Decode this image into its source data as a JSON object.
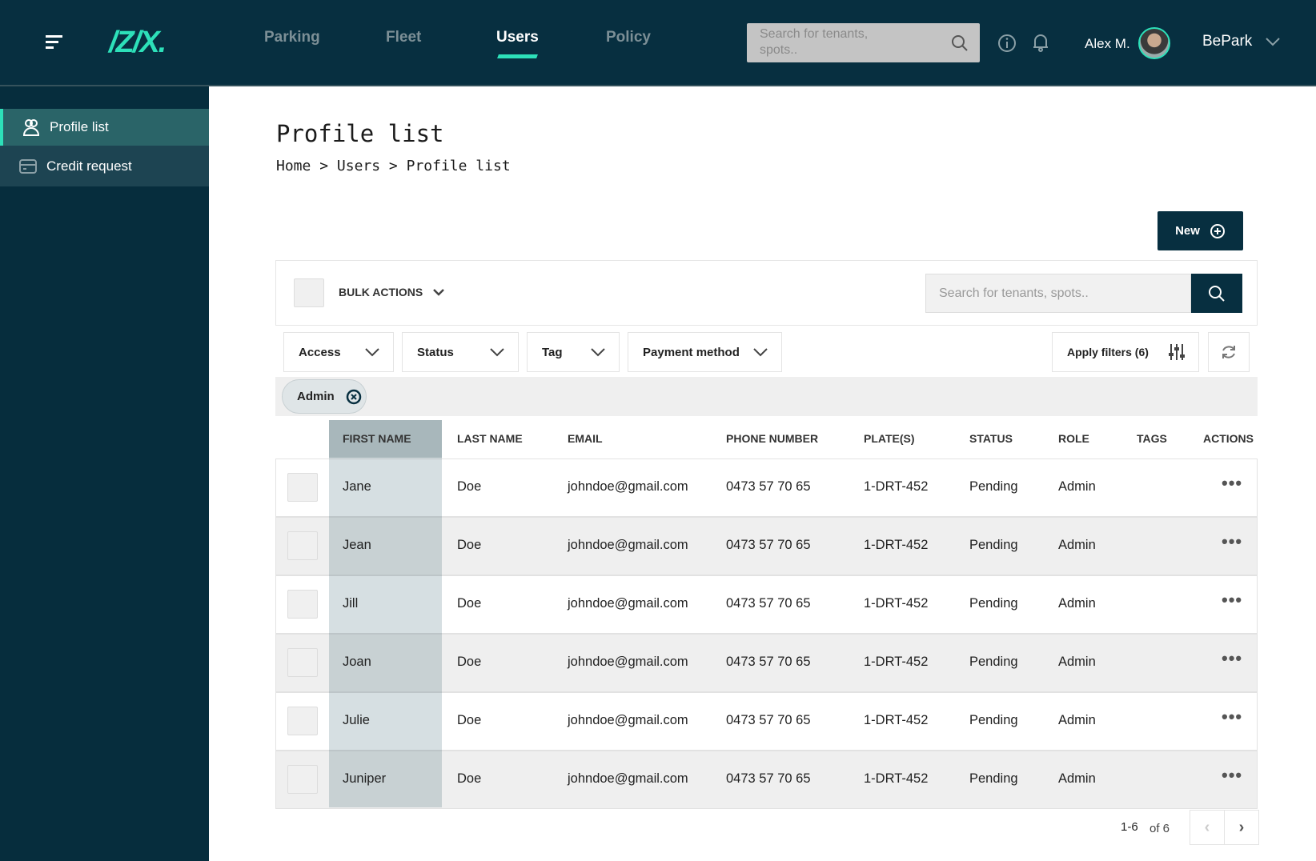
{
  "header": {
    "logo": "/Z/X.",
    "nav": [
      "Parking",
      "Fleet",
      "Users",
      "Policy"
    ],
    "active_nav": "Users",
    "search_placeholder": "Search for tenants, spots..",
    "user_name": "Alex M.",
    "org": "BePark"
  },
  "sidebar": {
    "items": [
      {
        "label": "Profile list",
        "icon": "users-icon",
        "active": true
      },
      {
        "label": "Credit request",
        "icon": "credit-card-icon",
        "active": false
      }
    ]
  },
  "page": {
    "title": "Profile list",
    "breadcrumb": [
      "Home",
      "Users",
      "Profile list"
    ],
    "breadcrumb_sep": ">",
    "new_label": "New"
  },
  "toolbar": {
    "bulk_actions": "BULK ACTIONS",
    "search_placeholder": "Search for tenants, spots.."
  },
  "filters": {
    "items": [
      "Access",
      "Status",
      "Tag",
      "Payment method"
    ],
    "apply_label": "Apply filters (6)",
    "chips": [
      "Admin"
    ]
  },
  "table": {
    "columns": [
      "FIRST NAME",
      "LAST NAME",
      "EMAIL",
      "PHONE NUMBER",
      "PLATE(S)",
      "STATUS",
      "ROLE",
      "TAGS",
      "ACTIONS"
    ],
    "rows": [
      [
        "Jane",
        "Doe",
        "johndoe@gmail.com",
        "0473 57 70 65",
        "1-DRT-452",
        "Pending",
        "Admin",
        ""
      ],
      [
        "Jean",
        "Doe",
        "johndoe@gmail.com",
        "0473 57 70 65",
        "1-DRT-452",
        "Pending",
        "Admin",
        ""
      ],
      [
        "Jill",
        "Doe",
        "johndoe@gmail.com",
        "0473 57 70 65",
        "1-DRT-452",
        "Pending",
        "Admin",
        ""
      ],
      [
        "Joan",
        "Doe",
        "johndoe@gmail.com",
        "0473 57 70 65",
        "1-DRT-452",
        "Pending",
        "Admin",
        ""
      ],
      [
        "Julie",
        "Doe",
        "johndoe@gmail.com",
        "0473 57 70 65",
        "1-DRT-452",
        "Pending",
        "Admin",
        ""
      ],
      [
        "Juniper",
        "Doe",
        "johndoe@gmail.com",
        "0473 57 70 65",
        "1-DRT-452",
        "Pending",
        "Admin",
        ""
      ]
    ]
  },
  "pagination": {
    "range": "1-6",
    "total": "of 6"
  },
  "colors": {
    "header": "#072f40",
    "accent": "#2de0b9",
    "sidebar_active": "#2a6468"
  }
}
